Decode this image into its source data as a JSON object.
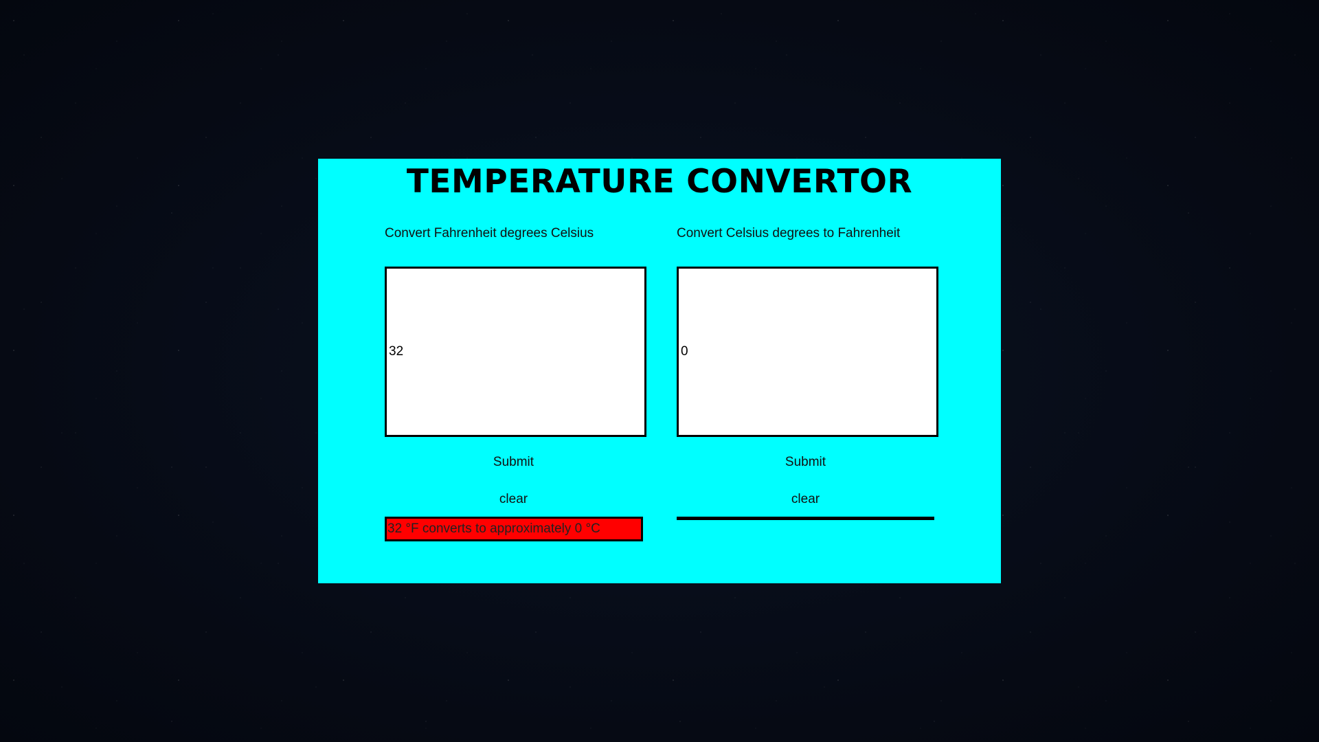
{
  "page": {
    "title": "TEMPERATURE CONVERTOR",
    "panel_color": "#00ffff",
    "background": "dark starfield"
  },
  "fahrenheit_to_celsius": {
    "label": "Convert Fahrenheit degrees Celsius",
    "input_value": "32",
    "submit_label": "Submit",
    "clear_label": "clear",
    "result_text": "32 °F converts to approximately 0 °C",
    "result_color": "#ff0000"
  },
  "celsius_to_fahrenheit": {
    "label": "Convert Celsius degrees to Fahrenheit",
    "input_value": "0",
    "submit_label": "Submit",
    "clear_label": "clear",
    "result_text": ""
  }
}
